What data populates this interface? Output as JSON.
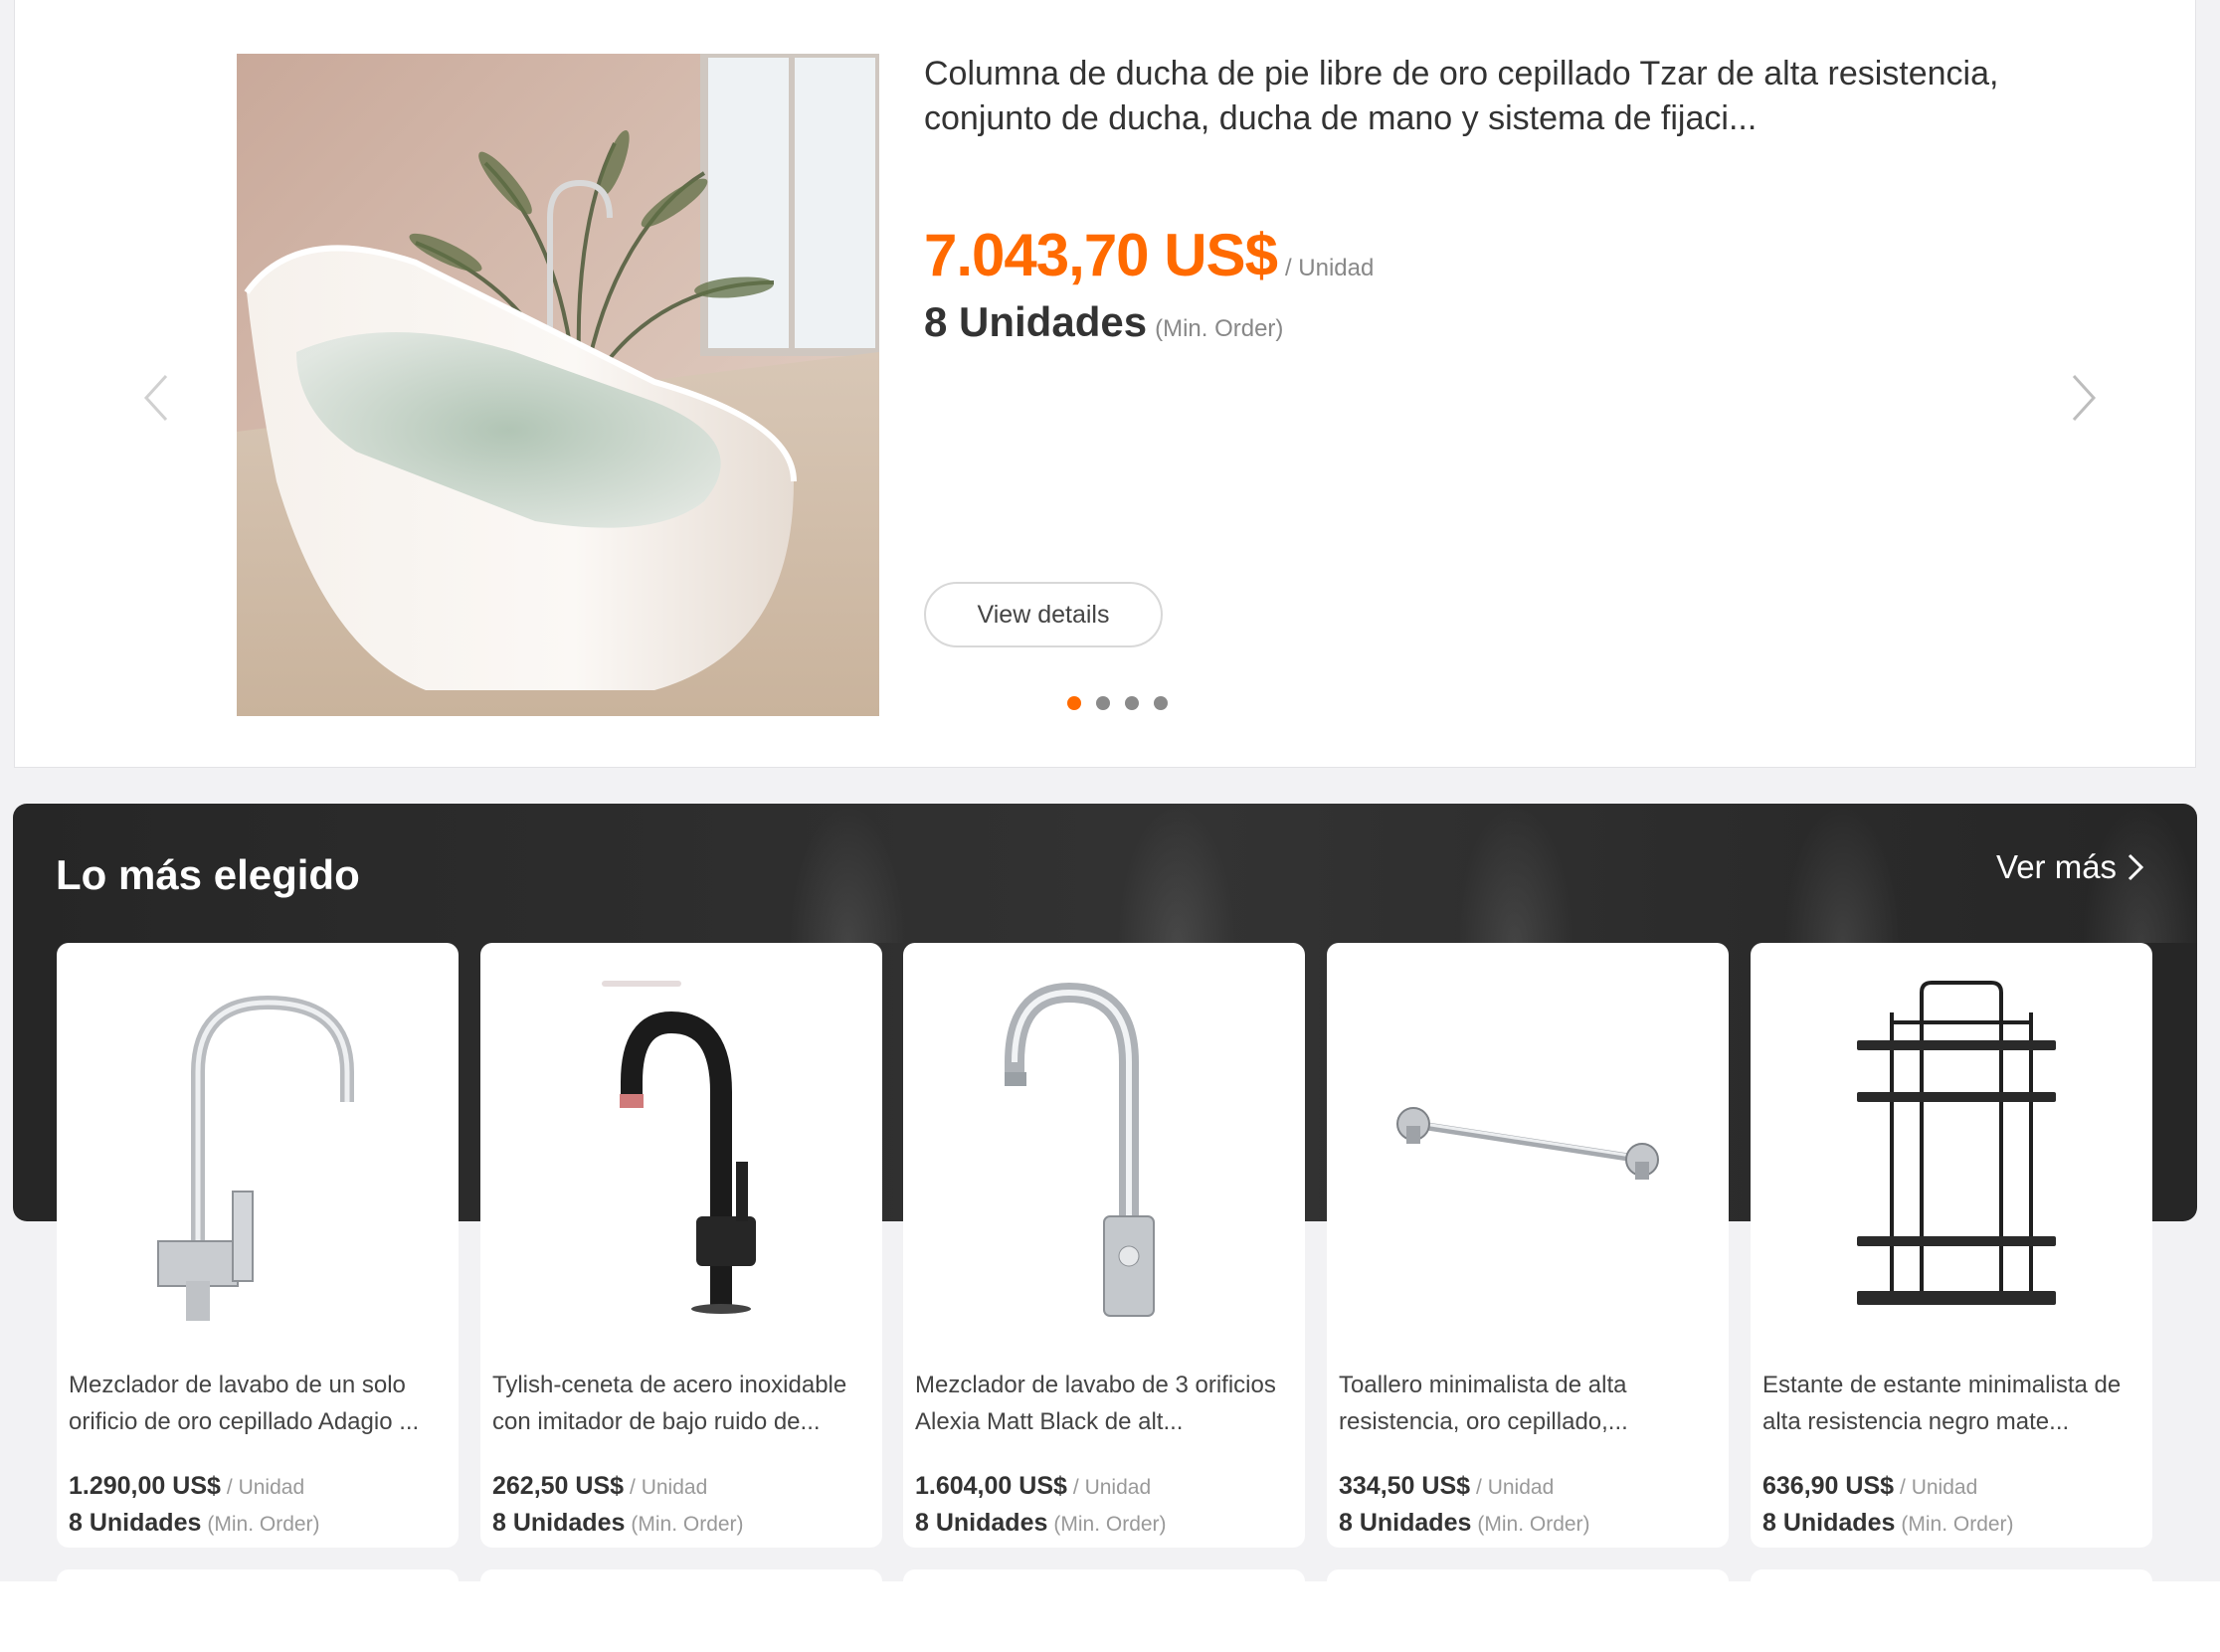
{
  "hero": {
    "title": "Columna de ducha de pie libre de oro cepillado Tzar de alta resistencia, conjunto de ducha, ducha de mano y sistema de fijaci...",
    "price": "7.043,70 US$",
    "unit": "/ Unidad",
    "moq": "8 Unidades",
    "moq_note": "(Min. Order)",
    "view_details_label": "View details",
    "dots": 4,
    "active_dot": 1,
    "accent_color": "#ff6a00"
  },
  "popular": {
    "title": "Lo más elegido",
    "see_more_label": "Ver más",
    "products": [
      {
        "name": "Mezclador de lavabo de un solo orificio de oro cepillado Adagio ...",
        "price": "1.290,00 US$",
        "unit": "/ Unidad",
        "moq": "8 Unidades",
        "moq_note": "(Min. Order)",
        "icon": "chrome-faucet-icon"
      },
      {
        "name": "Tylish-ceneta de acero inoxidable con imitador de bajo ruido de...",
        "price": "262,50 US$",
        "unit": "/ Unidad",
        "moq": "8 Unidades",
        "moq_note": "(Min. Order)",
        "icon": "black-faucet-icon"
      },
      {
        "name": "Mezclador de lavabo de 3 orificios Alexia Matt Black de alt...",
        "price": "1.604,00 US$",
        "unit": "/ Unidad",
        "moq": "8 Unidades",
        "moq_note": "(Min. Order)",
        "icon": "gooseneck-faucet-icon"
      },
      {
        "name": "Toallero minimalista de alta resistencia, oro cepillado,...",
        "price": "334,50 US$",
        "unit": "/ Unidad",
        "moq": "8 Unidades",
        "moq_note": "(Min. Order)",
        "icon": "towel-bar-icon"
      },
      {
        "name": "Estante de estante minimalista de alta resistencia negro mate...",
        "price": "636,90 US$",
        "unit": "/ Unidad",
        "moq": "8 Unidades",
        "moq_note": "(Min. Order)",
        "icon": "shower-shelf-icon"
      }
    ]
  }
}
